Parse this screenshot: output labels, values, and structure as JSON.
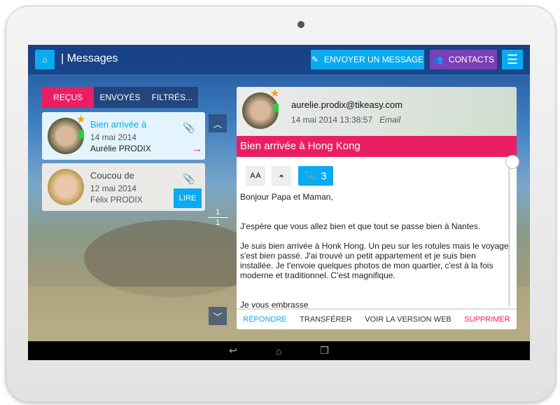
{
  "header": {
    "title": "| Messages",
    "send_label": "ENVOYER UN MESSAGE",
    "contacts_label": "CONTACTS"
  },
  "tabs": [
    {
      "label": "REÇUS",
      "active": true
    },
    {
      "label": "ENVOYÉS"
    },
    {
      "label": "FILTRÉS..."
    }
  ],
  "messages": [
    {
      "subject": "Bien arrivée à",
      "date": "14 mai 2014",
      "from": "Aurélie PRODIX",
      "selected": true
    },
    {
      "subject": "Coucou de",
      "date": "12 mai 2014",
      "from": "Félix PRODIX",
      "read_label": "LIRE"
    }
  ],
  "pager": {
    "current": "1",
    "total": "1"
  },
  "detail": {
    "email": "aurelie.prodix@tikeasy.com",
    "datetime": "14 mai 2014 13:38:57",
    "type": "Email",
    "subject": "Bien arrivée à Hong Kong",
    "font_label": "AA",
    "attachments": "3",
    "body": [
      "Bonjour Papa et Maman,",
      "J'espère que vous allez bien et que tout se passe bien à Nantes.",
      "Je suis bien arrivée à Honk Hong. Un peu sur les rotules mais le voyage s'est bien passé. J'ai trouvé un petit appartement et je suis bien installée. Je t'envoie quelques photos de mon quartier, c'est à la fois moderne et traditionnel. C'est magnifique.",
      "Je vous embrasse"
    ],
    "actions": {
      "reply": "RÉPONDRE",
      "forward": "TRANSFÉRER",
      "web": "VOIR LA VERSION WEB",
      "delete": "SUPPRIMER"
    }
  },
  "colors": {
    "accent": "#0aaaf0",
    "pink": "#e91e63",
    "purple": "#7b3fb6"
  }
}
